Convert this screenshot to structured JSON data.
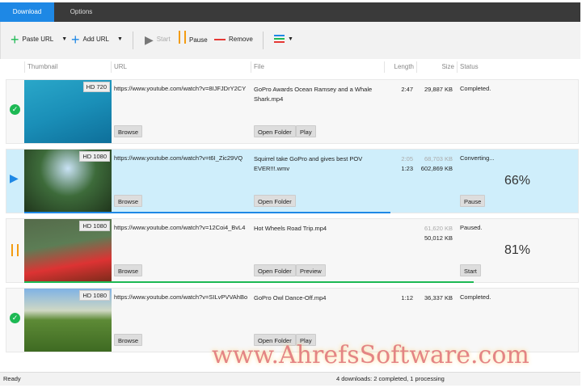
{
  "tabs": [
    {
      "label": "Download"
    },
    {
      "label": "Options"
    }
  ],
  "toolbar": {
    "paste_url": "Paste URL",
    "add_url": "Add URL",
    "start": "Start",
    "pause": "Pause",
    "remove": "Remove"
  },
  "columns": {
    "thumbnail": "Thumbnail",
    "url": "URL",
    "file": "File",
    "length": "Length",
    "size": "Size",
    "status": "Status"
  },
  "rows": [
    {
      "quality": "HD 720",
      "url": "https://www.youtube.com/watch?v=8IJFJDrY2CY",
      "file": "GoPro Awards  Ocean Ramsey and a Whale Shark.mp4",
      "length": "2:47",
      "length2": "",
      "size": "29,887 KB",
      "size2": "",
      "status": "Completed.",
      "percent": "",
      "icon": "check-icon",
      "browse": "Browse",
      "open_folder": "Open Folder",
      "action": "Play"
    },
    {
      "quality": "HD 1080",
      "url": "https://www.youtube.com/watch?v=t6I_Zic29VQ",
      "file": "Squirrel take GoPro and gives best POV EVER!!!.wmv",
      "length": "2:05",
      "length2": "1:23",
      "size": "68,703 KB",
      "size2": "602,869 KB",
      "status": "Converting...",
      "percent": "66%",
      "progress": 0.66,
      "icon": "play-icon",
      "browse": "Browse",
      "open_folder": "Open Folder",
      "action": "Pause"
    },
    {
      "quality": "HD 1080",
      "url": "https://www.youtube.com/watch?v=12Coi4_BvL4",
      "file": "Hot Wheels Road Trip.mp4",
      "length": "",
      "length2": "",
      "size": "61,620 KB",
      "size2": "50,012 KB",
      "status": "Paused.",
      "percent": "81%",
      "progress": 0.81,
      "icon": "pause-icon",
      "browse": "Browse",
      "open_folder": "Open Folder",
      "action": "Preview",
      "action2": "Start"
    },
    {
      "quality": "HD 1080",
      "url": "https://www.youtube.com/watch?v=SILvPVVAhBo",
      "file": "GoPro  Owl Dance-Off.mp4",
      "length": "1:12",
      "length2": "",
      "size": "36,337 KB",
      "size2": "",
      "status": "Completed.",
      "percent": "",
      "icon": "check-icon",
      "browse": "Browse",
      "open_folder": "Open Folder",
      "action": "Play"
    }
  ],
  "statusbar": {
    "left": "Ready",
    "summary": "4 downloads: 2 completed, 1 processing"
  },
  "watermark": "www.AhrefsSoftware.com",
  "colors": {
    "accent": "#1e88e5",
    "success": "#1db954",
    "pause": "#f39c12",
    "remove": "#e53935"
  }
}
